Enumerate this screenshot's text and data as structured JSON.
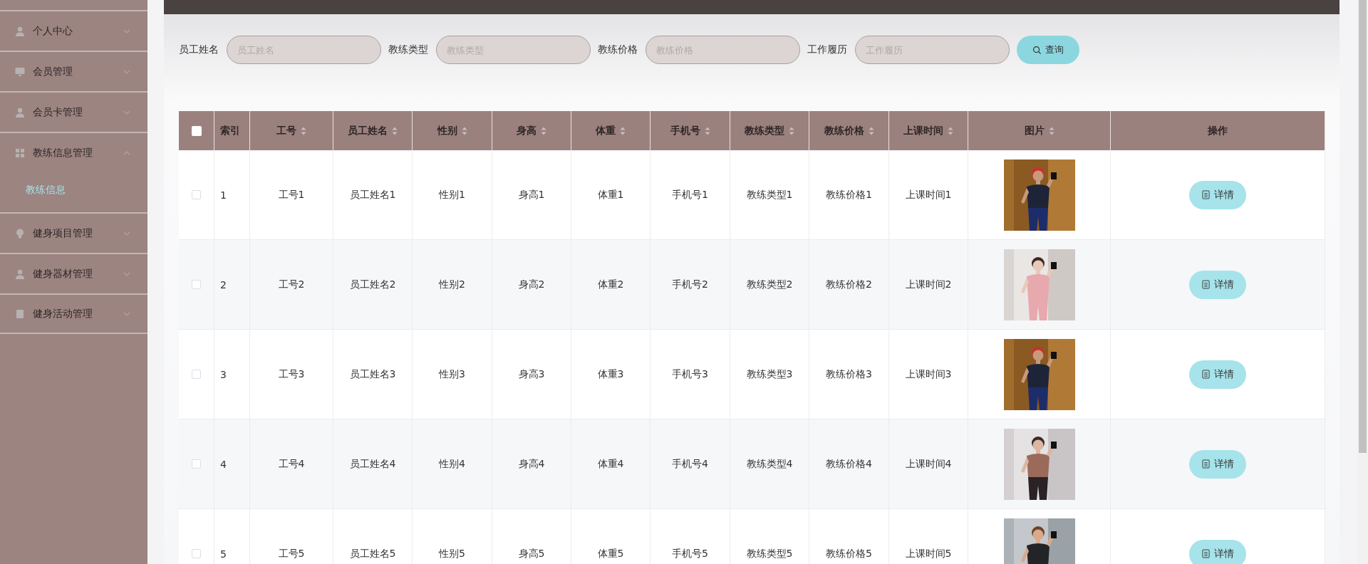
{
  "sidebar": {
    "items": [
      {
        "label": "个人中心",
        "expanded": false
      },
      {
        "label": "会员管理",
        "expanded": false
      },
      {
        "label": "会员卡管理",
        "expanded": false
      },
      {
        "label": "教练信息管理",
        "expanded": true,
        "children": [
          {
            "label": "教练信息",
            "selected": true
          }
        ]
      },
      {
        "label": "健身项目管理",
        "expanded": false
      },
      {
        "label": "健身器材管理",
        "expanded": false
      },
      {
        "label": "健身活动管理",
        "expanded": false
      }
    ]
  },
  "search": {
    "fields": [
      {
        "label": "员工姓名",
        "placeholder": "员工姓名"
      },
      {
        "label": "教练类型",
        "placeholder": "教练类型"
      },
      {
        "label": "教练价格",
        "placeholder": "教练价格"
      },
      {
        "label": "工作履历",
        "placeholder": "工作履历"
      }
    ],
    "button": "查询"
  },
  "table": {
    "header_checked": false,
    "columns": [
      {
        "label": "索引",
        "sortable": false
      },
      {
        "label": "工号",
        "sortable": true
      },
      {
        "label": "员工姓名",
        "sortable": true
      },
      {
        "label": "性别",
        "sortable": true
      },
      {
        "label": "身高",
        "sortable": true
      },
      {
        "label": "体重",
        "sortable": true
      },
      {
        "label": "手机号",
        "sortable": true
      },
      {
        "label": "教练类型",
        "sortable": true
      },
      {
        "label": "教练价格",
        "sortable": true
      },
      {
        "label": "上课时间",
        "sortable": true
      },
      {
        "label": "图片",
        "sortable": true
      },
      {
        "label": "操作",
        "sortable": false
      }
    ],
    "rows": [
      {
        "checked": false,
        "cells": [
          "1",
          "工号1",
          "员工姓名1",
          "性别1",
          "身高1",
          "体重1",
          "手机号1",
          "教练类型1",
          "教练价格1",
          "上课时间1"
        ],
        "action": "详情"
      },
      {
        "checked": false,
        "cells": [
          "2",
          "工号2",
          "员工姓名2",
          "性别2",
          "身高2",
          "体重2",
          "手机号2",
          "教练类型2",
          "教练价格2",
          "上课时间2"
        ],
        "action": "详情"
      },
      {
        "checked": false,
        "cells": [
          "3",
          "工号3",
          "员工姓名3",
          "性别3",
          "身高3",
          "体重3",
          "手机号3",
          "教练类型3",
          "教练价格3",
          "上课时间3"
        ],
        "action": "详情"
      },
      {
        "checked": false,
        "cells": [
          "4",
          "工号4",
          "员工姓名4",
          "性别4",
          "身高4",
          "体重4",
          "手机号4",
          "教练类型4",
          "教练价格4",
          "上课时间4"
        ],
        "action": "详情"
      },
      {
        "checked": false,
        "cells": [
          "5",
          "工号5",
          "员工姓名5",
          "性别5",
          "身高5",
          "体重5",
          "手机号5",
          "教练类型5",
          "教练价格5",
          "上课时间5"
        ],
        "action": "详情"
      }
    ]
  }
}
